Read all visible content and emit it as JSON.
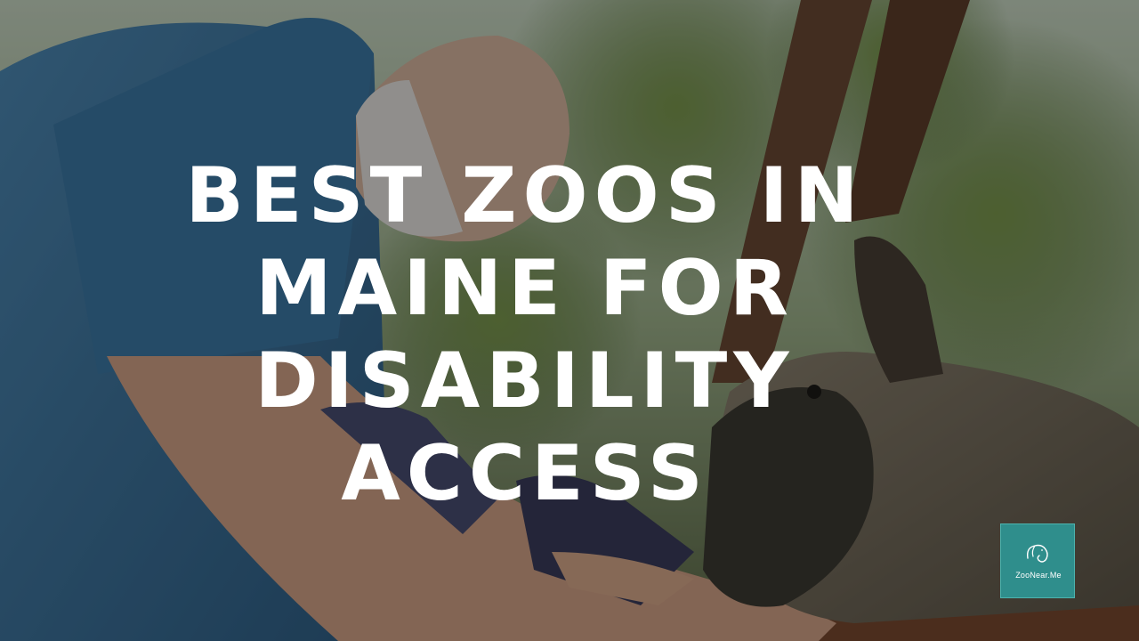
{
  "headline": {
    "lines": [
      "BEST ZOOS IN",
      "MAINE FOR",
      "DISABILITY",
      "ACCESS"
    ]
  },
  "logo": {
    "text": "ZooNear.Me",
    "icon": "elephant-logo-icon",
    "color": "#2f8e8c"
  },
  "photo": {
    "subject": "man-feeding-sheep-photo"
  }
}
